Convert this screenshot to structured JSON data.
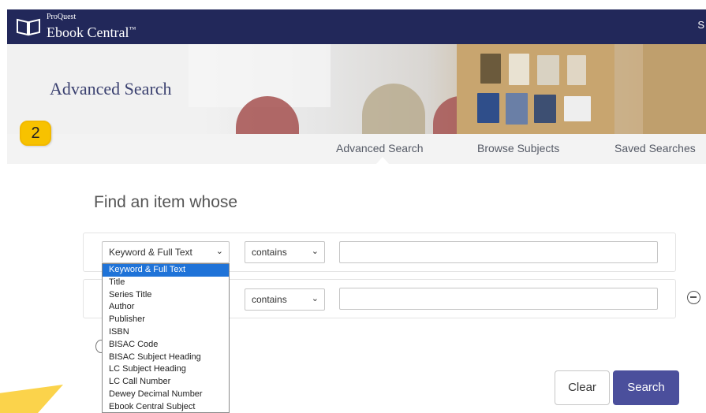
{
  "header": {
    "brand_small": "ProQuest",
    "brand_name": "Ebook Central",
    "brand_tm": "™",
    "top_right": "S",
    "icons": {
      "logo": "open-book-icon"
    }
  },
  "hero": {
    "title": "Advanced Search"
  },
  "badge": {
    "number": "2",
    "color": "#f7c200"
  },
  "tabs": [
    {
      "label": "Advanced Search",
      "active": true
    },
    {
      "label": "Browse Subjects",
      "active": false
    },
    {
      "label": "Saved Searches",
      "active": false
    }
  ],
  "search": {
    "heading": "Find an item whose",
    "row1": {
      "field": "Keyword & Full Text",
      "operator": "contains",
      "value": ""
    },
    "row2": {
      "operator": "contains",
      "value": ""
    },
    "field_options": [
      "Keyword & Full Text",
      "Title",
      "Series Title",
      "Author",
      "Publisher",
      "ISBN",
      "BISAC Code",
      "BISAC Subject Heading",
      "LC Subject Heading",
      "LC Call Number",
      "Dewey Decimal Number",
      "Ebook Central Subject"
    ],
    "selected_option": "Keyword & Full Text"
  },
  "buttons": {
    "clear": "Clear",
    "search": "Search"
  },
  "colors": {
    "topbar": "#22285a",
    "title": "#3b4170",
    "search_button": "#4b4f9c",
    "dropdown_highlight": "#1f73d8",
    "arrow": "#fbd34b"
  }
}
